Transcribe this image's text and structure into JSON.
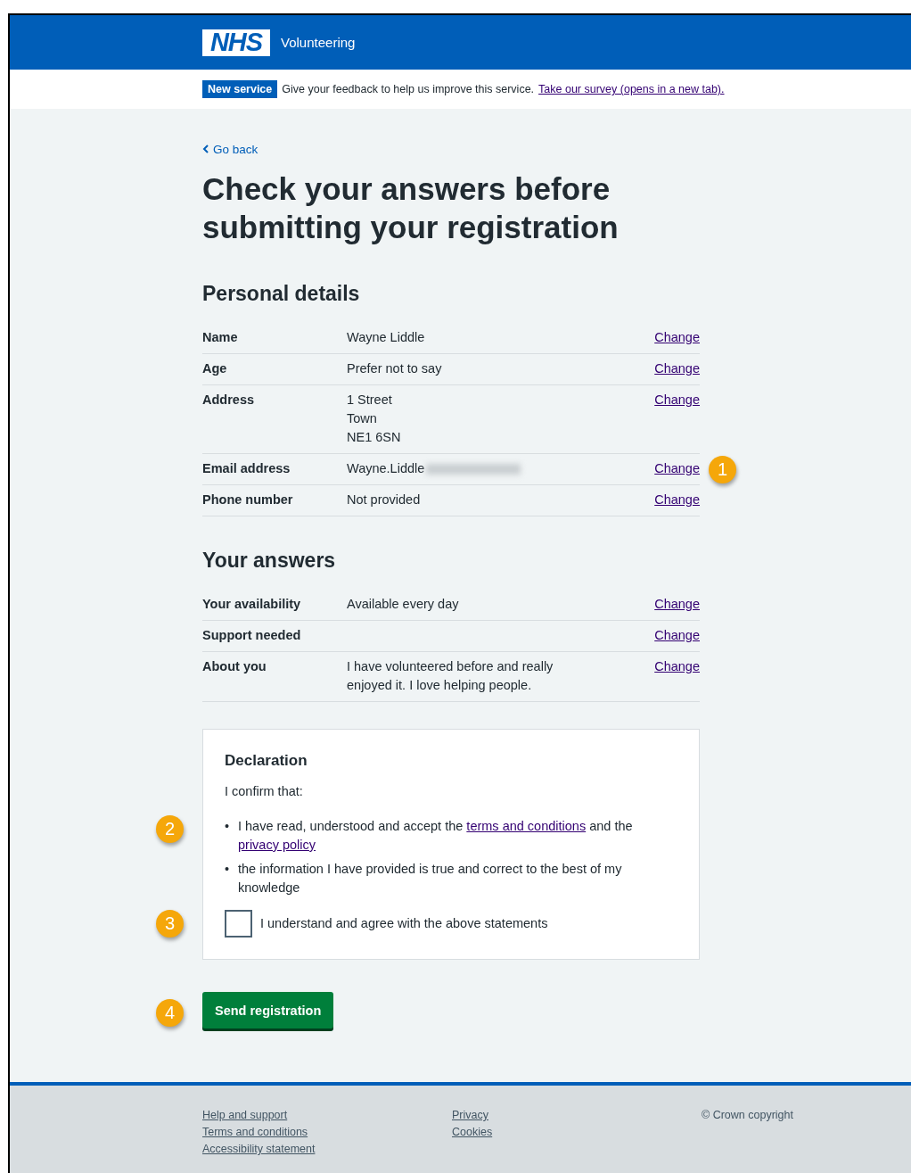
{
  "header": {
    "logo": "NHS",
    "service": "Volunteering"
  },
  "phase_banner": {
    "tag": "New service",
    "text": "Give your feedback to help us improve this service.",
    "link": "Take our survey (opens in a new tab)."
  },
  "back_link": "Go back",
  "title": "Check your answers before submitting your registration",
  "sections": [
    {
      "heading": "Personal details",
      "rows": [
        {
          "key": "Name",
          "value": [
            "Wayne Liddle"
          ],
          "action": "Change"
        },
        {
          "key": "Age",
          "value": [
            "Prefer not to say"
          ],
          "action": "Change"
        },
        {
          "key": "Address",
          "value": [
            "1 Street",
            "Town",
            "NE1 6SN"
          ],
          "action": "Change"
        },
        {
          "key": "Email address",
          "value": [
            "Wayne.Liddle"
          ],
          "redacted": true,
          "action": "Change",
          "annotation": "1"
        },
        {
          "key": "Phone number",
          "value": [
            "Not provided"
          ],
          "action": "Change"
        }
      ]
    },
    {
      "heading": "Your answers",
      "rows": [
        {
          "key": "Your availability",
          "value": [
            "Available every day"
          ],
          "action": "Change"
        },
        {
          "key": "Support needed",
          "value": [],
          "action": "Change"
        },
        {
          "key": "About you",
          "value": [
            "I have volunteered before and really enjoyed it. I love helping people."
          ],
          "action": "Change"
        }
      ]
    }
  ],
  "declaration": {
    "heading": "Declaration",
    "intro": "I confirm that:",
    "bullets": [
      {
        "marker": "•",
        "parts": [
          {
            "text": "I have read, understood and accept the "
          },
          {
            "link": "terms and conditions"
          },
          {
            "text": " and the "
          },
          {
            "link": "privacy policy"
          }
        ],
        "annotation": "2"
      },
      {
        "marker": "•",
        "parts": [
          {
            "text": "the information I have provided is true and correct to the best of my knowledge"
          }
        ]
      }
    ],
    "checkbox": {
      "label": "I understand and agree with the above statements",
      "checked": false,
      "annotation": "3"
    }
  },
  "submit": {
    "label": "Send registration",
    "annotation": "4"
  },
  "footer": {
    "columns": [
      [
        "Help and support",
        "Terms and conditions",
        "Accessibility statement"
      ],
      [
        "Privacy",
        "Cookies"
      ]
    ],
    "copyright": "© Crown copyright"
  }
}
